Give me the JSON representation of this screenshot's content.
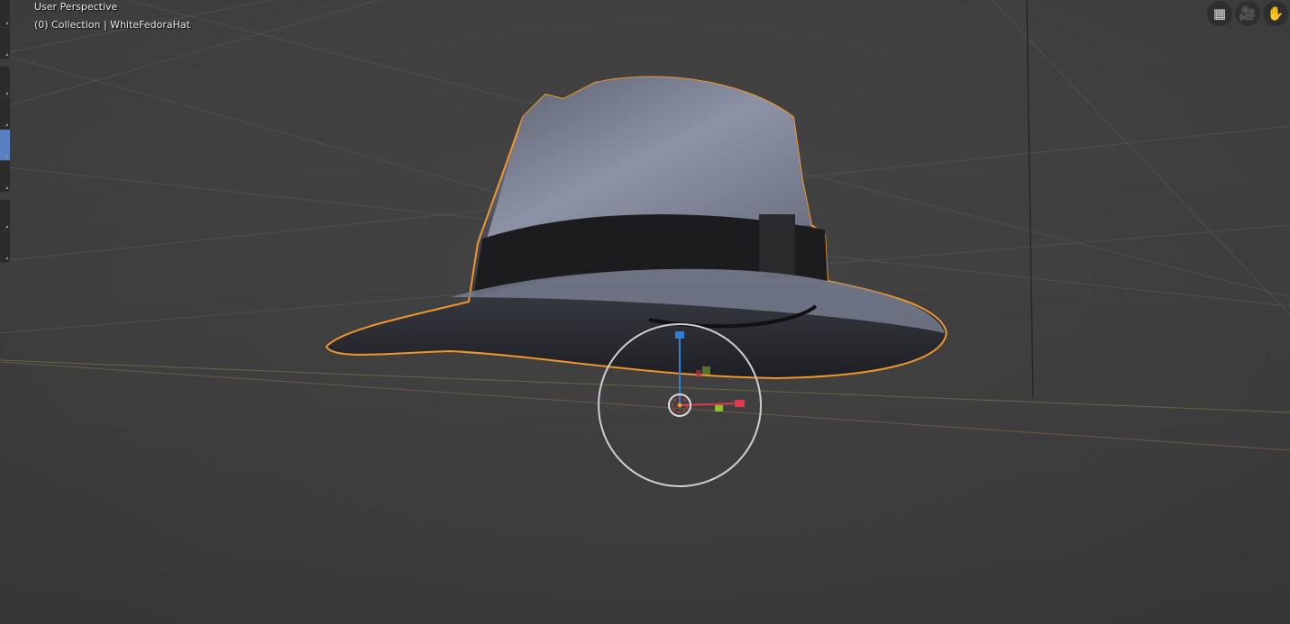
{
  "viewport": {
    "perspective_label": "User Perspective",
    "collection_label": "(0) Collection | WhiteFedoraHat"
  },
  "nav_icons": [
    {
      "name": "grid-icon",
      "glyph": "▦"
    },
    {
      "name": "camera-icon",
      "glyph": "🎥"
    },
    {
      "name": "hand-icon",
      "glyph": "✋"
    }
  ],
  "toolbar": {
    "active_index": 4
  },
  "colors": {
    "background": "#3f3f3f",
    "selection_outline": "#f0962c",
    "active_tool": "#5680c2",
    "x_axis": "#e0384f",
    "y_axis": "#8cc21c",
    "z_axis": "#2f7fd6"
  }
}
